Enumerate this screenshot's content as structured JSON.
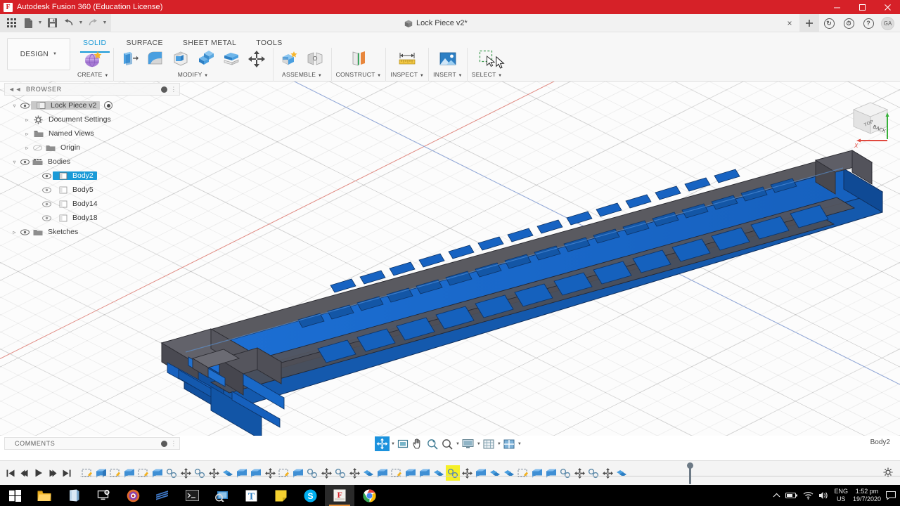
{
  "titlebar": {
    "logo": "F",
    "title": "Autodesk Fusion 360 (Education License)",
    "minimize": "minimize-icon",
    "maximize": "maximize-icon",
    "close": "close-icon"
  },
  "quick_access": {
    "grid_icon": "app-grid-icon",
    "new_icon": "new-document-icon",
    "save_icon": "save-icon",
    "undo_icon": "undo-icon",
    "redo_icon": "redo-icon",
    "document_tab": "Lock Piece v2*",
    "tab_close": "×",
    "add_tab": "+",
    "help_badge": "?",
    "avatar_initials": "GA"
  },
  "ribbon": {
    "workspace": "DESIGN",
    "tabs": [
      {
        "label": "SOLID",
        "active": true
      },
      {
        "label": "SURFACE",
        "active": false
      },
      {
        "label": "SHEET METAL",
        "active": false
      },
      {
        "label": "TOOLS",
        "active": false
      }
    ],
    "panels": [
      {
        "label": "CREATE",
        "dropdown": true,
        "tools": [
          "create-form-icon"
        ]
      },
      {
        "label": "MODIFY",
        "dropdown": true,
        "tools": [
          "press-pull-icon",
          "fillet-icon",
          "shell-icon",
          "combine-icon",
          "split-face-icon",
          "move-copy-icon"
        ]
      },
      {
        "label": "ASSEMBLE",
        "dropdown": true,
        "tools": [
          "new-component-icon",
          "joint-icon"
        ]
      },
      {
        "label": "CONSTRUCT",
        "dropdown": true,
        "tools": [
          "offset-plane-icon"
        ]
      },
      {
        "label": "INSPECT",
        "dropdown": true,
        "tools": [
          "measure-icon"
        ]
      },
      {
        "label": "INSERT",
        "dropdown": true,
        "tools": [
          "insert-image-icon"
        ]
      },
      {
        "label": "SELECT",
        "dropdown": true,
        "tools": [
          "window-selection-icon"
        ]
      }
    ]
  },
  "browser": {
    "title": "BROWSER",
    "collapse_icon": "collapse-left-icon",
    "options_icon": "panel-options-icon",
    "tree": [
      {
        "label": "Lock Piece v2",
        "indent": 0,
        "arrow": "expanded",
        "eye": true,
        "icon": "component-icon",
        "state": "root",
        "radio": true
      },
      {
        "label": "Document Settings",
        "indent": 1,
        "arrow": "collapsed",
        "eye": false,
        "icon": "settings-gear-icon",
        "state": "normal",
        "radio": false
      },
      {
        "label": "Named Views",
        "indent": 1,
        "arrow": "collapsed",
        "eye": false,
        "icon": "folder-icon",
        "state": "normal",
        "radio": false
      },
      {
        "label": "Origin",
        "indent": 1,
        "arrow": "collapsed",
        "eye": "hidden",
        "icon": "folder-icon",
        "state": "normal",
        "radio": false
      },
      {
        "label": "Bodies",
        "indent": 1,
        "arrow": "expanded",
        "eye": true,
        "icon": "bodies-folder-icon",
        "state": "normal",
        "radio": false
      },
      {
        "label": "Body2",
        "indent": 2,
        "arrow": "none",
        "eye": true,
        "icon": "body-icon",
        "state": "selected",
        "radio": false
      },
      {
        "label": "Body5",
        "indent": 2,
        "arrow": "none",
        "eye": true,
        "icon": "body-icon",
        "state": "normal",
        "radio": false
      },
      {
        "label": "Body14",
        "indent": 2,
        "arrow": "none",
        "eye": true,
        "icon": "body-icon",
        "state": "normal",
        "radio": false
      },
      {
        "label": "Body18",
        "indent": 2,
        "arrow": "none",
        "eye": true,
        "icon": "body-icon",
        "state": "normal",
        "radio": false
      },
      {
        "label": "Sketches",
        "indent": 1,
        "arrow": "collapsed",
        "eye": true,
        "icon": "folder-icon",
        "state": "normal",
        "radio": false
      }
    ]
  },
  "canvas": {
    "model_name": "Lock Piece v2",
    "body_color": "#1667c8",
    "body_color_dark": "#4c4c52",
    "edge_color": "#10305f",
    "background": "#fcfcfc",
    "viewcube": {
      "visible_face": "BACK",
      "axis_x": "X",
      "axis_x_color": "#e0493f",
      "axis_y_color": "#37b03a",
      "axis_z_color": "#3a6fd0"
    }
  },
  "comments": {
    "title": "COMMENTS",
    "add_icon": "add-comment-icon"
  },
  "navbar": {
    "items": [
      {
        "name": "orbit-icon",
        "active": true,
        "caret": true
      },
      {
        "name": "look-at-icon",
        "active": false,
        "caret": false
      },
      {
        "name": "pan-icon",
        "active": false,
        "caret": false
      },
      {
        "name": "zoom-icon",
        "active": false,
        "caret": false
      },
      {
        "name": "zoom-window-icon",
        "active": false,
        "caret": true
      },
      {
        "name": "display-settings-icon",
        "active": false,
        "caret": true
      },
      {
        "name": "grid-snaps-icon",
        "active": false,
        "caret": true
      },
      {
        "name": "viewports-icon",
        "active": false,
        "caret": true
      }
    ]
  },
  "status": {
    "selection": "Body2"
  },
  "timeline": {
    "playback": [
      "skip-start-icon",
      "step-back-icon",
      "play-icon",
      "step-forward-icon",
      "skip-end-icon"
    ],
    "features": [
      {
        "type": "sketch-feature-icon",
        "marked": false
      },
      {
        "type": "extrude-feature-icon",
        "marked": false
      },
      {
        "type": "sketch-feature-icon",
        "marked": false
      },
      {
        "type": "extrude-feature-icon",
        "marked": false
      },
      {
        "type": "sketch-feature-icon",
        "marked": false
      },
      {
        "type": "extrude-feature-icon",
        "marked": false
      },
      {
        "type": "fillet-feature-icon",
        "marked": false
      },
      {
        "type": "move-feature-icon",
        "marked": false
      },
      {
        "type": "fillet-feature-icon",
        "marked": false
      },
      {
        "type": "move-feature-icon",
        "marked": false
      },
      {
        "type": "combine-feature-icon",
        "marked": false
      },
      {
        "type": "extrude-feature-icon",
        "marked": false
      },
      {
        "type": "extrude-feature-icon",
        "marked": false
      },
      {
        "type": "move-feature-icon",
        "marked": false
      },
      {
        "type": "sketch-feature-icon",
        "marked": false
      },
      {
        "type": "extrude-feature-icon",
        "marked": false
      },
      {
        "type": "fillet-feature-icon",
        "marked": false
      },
      {
        "type": "move-feature-icon",
        "marked": false
      },
      {
        "type": "fillet-feature-icon",
        "marked": false
      },
      {
        "type": "move-feature-icon",
        "marked": false
      },
      {
        "type": "combine-feature-icon",
        "marked": false
      },
      {
        "type": "extrude-feature-icon",
        "marked": false
      },
      {
        "type": "sketch-feature-icon",
        "marked": false
      },
      {
        "type": "extrude-feature-icon",
        "marked": false
      },
      {
        "type": "extrude-feature-icon",
        "marked": false
      },
      {
        "type": "combine-feature-icon",
        "marked": false
      },
      {
        "type": "fillet-feature-icon",
        "marked": true
      },
      {
        "type": "move-feature-icon",
        "marked": false
      },
      {
        "type": "extrude-feature-icon",
        "marked": false
      },
      {
        "type": "combine-feature-icon",
        "marked": false
      },
      {
        "type": "combine-feature-icon",
        "marked": false
      },
      {
        "type": "sketch-feature-icon",
        "marked": false
      },
      {
        "type": "extrude-feature-icon",
        "marked": false
      },
      {
        "type": "extrude-feature-icon",
        "marked": false
      },
      {
        "type": "fillet-feature-icon",
        "marked": false
      },
      {
        "type": "move-feature-icon",
        "marked": false
      },
      {
        "type": "fillet-feature-icon",
        "marked": false
      },
      {
        "type": "move-feature-icon",
        "marked": false
      },
      {
        "type": "combine-feature-icon",
        "marked": false
      }
    ],
    "settings_icon": "timeline-settings-icon"
  },
  "taskbar": {
    "start": "windows-start-icon",
    "apps": [
      {
        "name": "file-explorer-icon",
        "active": false
      },
      {
        "name": "onenote-icon",
        "active": false
      },
      {
        "name": "teams-icon",
        "active": false
      },
      {
        "name": "fusion-hub-icon",
        "active": false
      },
      {
        "name": "solidworks-icon",
        "active": false
      },
      {
        "name": "terminal-icon",
        "active": false
      },
      {
        "name": "snip-tool-icon",
        "active": false
      },
      {
        "name": "text-editor-icon",
        "active": false
      },
      {
        "name": "sticky-notes-icon",
        "active": false
      },
      {
        "name": "skype-icon",
        "active": false
      },
      {
        "name": "fusion360-icon",
        "active": true
      },
      {
        "name": "chrome-icon",
        "active": false
      }
    ],
    "tray": {
      "chevron": "show-hidden-icons-icon",
      "battery": "battery-icon",
      "wifi": "wifi-icon",
      "volume": "volume-icon",
      "language_line1": "ENG",
      "language_line2": "US",
      "time": "1:52 pm",
      "date": "19/7/2020",
      "notifications": "action-center-icon"
    }
  }
}
